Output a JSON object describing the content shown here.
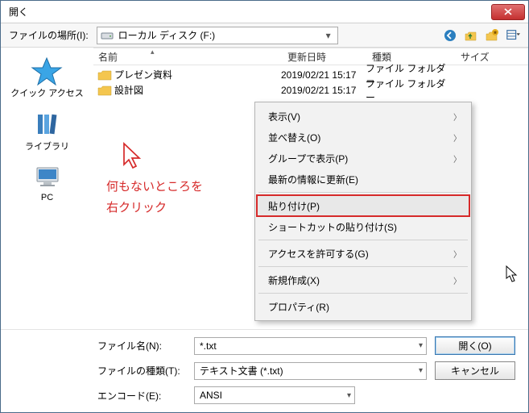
{
  "window": {
    "title": "開く"
  },
  "location": {
    "label": "ファイルの場所(I):",
    "value": "ローカル ディスク (F:)"
  },
  "columns": {
    "name": "名前",
    "date": "更新日時",
    "type": "種類",
    "size": "サイズ"
  },
  "rows": [
    {
      "name": "プレゼン資料",
      "date": "2019/02/21 15:17",
      "type": "ファイル フォルダー"
    },
    {
      "name": "設計図",
      "date": "2019/02/21 15:17",
      "type": "ファイル フォルダー"
    }
  ],
  "sidebar": {
    "quick": "クイック アクセス",
    "library": "ライブラリ",
    "pc": "PC"
  },
  "annotation": {
    "line1": "何もないところを",
    "line2": "右クリック"
  },
  "context_menu": [
    {
      "label": "表示(V)",
      "sub": true
    },
    {
      "label": "並べ替え(O)",
      "sub": true
    },
    {
      "label": "グループで表示(P)",
      "sub": true
    },
    {
      "label": "最新の情報に更新(E)"
    },
    {
      "sep": true
    },
    {
      "label": "貼り付け(P)",
      "highlight": true
    },
    {
      "label": "ショートカットの貼り付け(S)"
    },
    {
      "sep": true
    },
    {
      "label": "アクセスを許可する(G)",
      "sub": true
    },
    {
      "sep": true
    },
    {
      "label": "新規作成(X)",
      "sub": true
    },
    {
      "sep": true
    },
    {
      "label": "プロパティ(R)"
    }
  ],
  "bottom": {
    "filename_label": "ファイル名(N):",
    "filename_value": "*.txt",
    "filetype_label": "ファイルの種類(T):",
    "filetype_value": "テキスト文書 (*.txt)",
    "encoding_label": "エンコード(E):",
    "encoding_value": "ANSI",
    "open_btn": "開く(O)",
    "cancel_btn": "キャンセル"
  }
}
